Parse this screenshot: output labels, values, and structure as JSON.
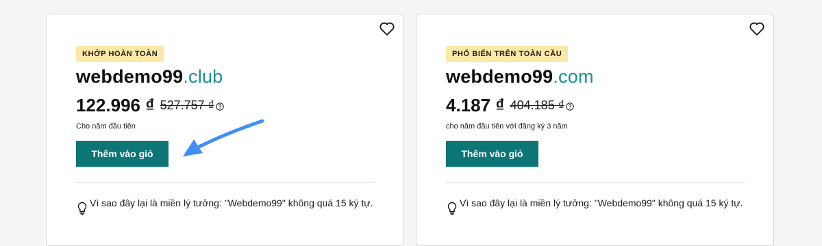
{
  "colors": {
    "accent_teal": "#0c7576",
    "tld_color": "#1a8f96",
    "badge_bg": "#fbe7a6",
    "arrow_color": "#3f8ff7"
  },
  "cards": [
    {
      "badge": "KHỚP HOÀN TOÀN",
      "domain_name": "webdemo99",
      "tld": ".club",
      "price": "122.996 ₫",
      "old_price": "527.757 ₫",
      "term": "Cho năm đầu tiên",
      "button_label": "Thêm vào giỏ",
      "tip": "Vì sao đây lại là miền lý tưởng: \"Webdemo99\" không quá 15 ký tự.",
      "favorite_icon": "heart-icon",
      "info_icon": "question-circle-icon",
      "tip_icon": "lightbulb-icon"
    },
    {
      "badge": "PHỔ BIẾN TRÊN TOÀN CẦU",
      "domain_name": "webdemo99",
      "tld": ".com",
      "price": "4.187 ₫",
      "old_price": "404.185 ₫",
      "term": "cho năm đầu tiên với đăng ký 3 năm",
      "button_label": "Thêm vào giỏ",
      "tip": "Vì sao đây lại là miền lý tưởng: \"Webdemo99\" không quá 15 ký tự.",
      "favorite_icon": "heart-icon",
      "info_icon": "question-circle-icon",
      "tip_icon": "lightbulb-icon"
    }
  ],
  "annotation": {
    "icon": "arrow-annotation"
  }
}
